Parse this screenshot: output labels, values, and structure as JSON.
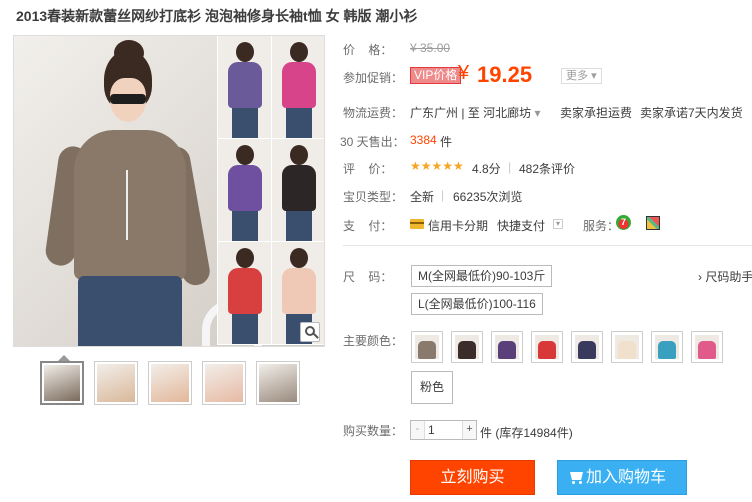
{
  "title": "2013春装新款蕾丝网纱打底衫 泡泡袖修身长袖t恤 女 韩版 潮小衫",
  "gallery": {
    "main_colors": [
      "#6b5a9a",
      "#d8448a",
      "#6e4fa0",
      "#2c2626",
      "#d84040",
      "#efc9b5"
    ],
    "thumbs": [
      "#7a6a5c",
      "#d9b89a",
      "#e3b79a",
      "#e7b9a4",
      "#9a8a7e"
    ]
  },
  "labels": {
    "price": "价    格：",
    "promo": "参加促销：",
    "shipping": "物流运费：",
    "sold": "30 天售出：",
    "rating": "评    价：",
    "type": "宝贝类型：",
    "payment": "支    付：",
    "size": "尺    码：",
    "color": "主要颜色：",
    "qty": "购买数量："
  },
  "price": {
    "original": "¥ 35.00",
    "vip_badge": "VIP价格",
    "yen": "¥",
    "current": "19.25",
    "more": "更多"
  },
  "shipping": {
    "route": "广东广州 | 至  河北廊坊",
    "seller": "卖家承担运费",
    "promise": "卖家承诺7天内发货"
  },
  "sold": {
    "count": "3384",
    "unit": "件"
  },
  "rating": {
    "stars": "★★★★★",
    "score": "4.8分",
    "sep": "|",
    "reviews": "482条评价"
  },
  "item_type": {
    "condition": "全新",
    "sep": "|",
    "views": "66235次浏览"
  },
  "payment": {
    "credit": "信用卡分期",
    "quick": "快捷支付",
    "more": "▾",
    "service_label": "服务：",
    "icon7": "7"
  },
  "sizes": [
    "M(全网最低价)90-103斤",
    "L(全网最低价)100-116"
  ],
  "size_help": "› 尺码助手",
  "colors": [
    "#8a7a6e",
    "#3a2d2a",
    "#5a3f7a",
    "#d83838",
    "#3a3a5e",
    "#f0e0cc",
    "#3aa0c0",
    "#e05a8a"
  ],
  "color_text_option": "粉色",
  "quantity": {
    "minus": "-",
    "value": "1",
    "plus": "+",
    "unit": "件 (库存14984件)"
  },
  "buttons": {
    "buy": "立刻购买",
    "cart": "加入购物车"
  }
}
